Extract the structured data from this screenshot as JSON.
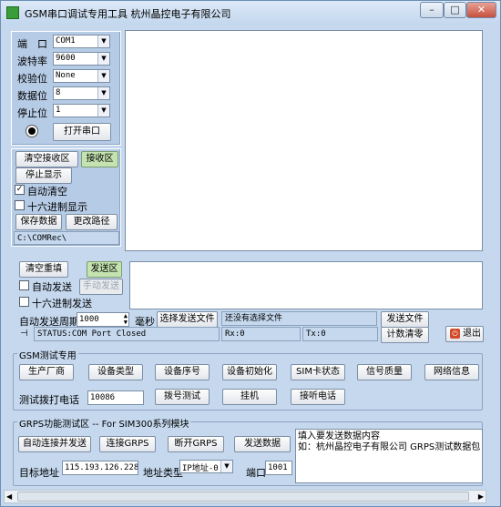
{
  "window": {
    "title": "GSM串口调试专用工具 杭州晶控电子有限公司",
    "min": "–",
    "max": "□",
    "close": "✕"
  },
  "serial": {
    "port_label": "端　口",
    "port_value": "COM1",
    "baud_label": "波特率",
    "baud_value": "9600",
    "parity_label": "校验位",
    "parity_value": "None",
    "databits_label": "数据位",
    "databits_value": "8",
    "stopbits_label": "停止位",
    "stopbits_value": "1",
    "open_label": "打开串口"
  },
  "receive": {
    "clear_label": "清空接收区",
    "area_label": "接收区",
    "stop_label": "停止显示",
    "auto_clear_label": "自动清空",
    "hex_label": "十六进制显示",
    "save_label": "保存数据",
    "change_path_label": "更改路径",
    "path_value": "C:\\COMRec\\"
  },
  "send": {
    "clear_label": "清空重填",
    "area_label": "发送区",
    "auto_label": "自动发送",
    "manual_label": "手动发送",
    "hex_label": "十六进制发送",
    "period_label": "自动发送周期",
    "period_value": "1000",
    "ms_label": "毫秒",
    "choose_file_label": "选择发送文件",
    "file_status": "还没有选择文件",
    "send_file_label": "发送文件",
    "count_clear_label": "计数清零",
    "exit_label": "退出",
    "status_text": "STATUS:COM Port Closed",
    "rx_text": "Rx:0",
    "tx_text": "Tx:0"
  },
  "gsm": {
    "group_title": "GSM测试专用",
    "buttons": [
      "生产厂商",
      "设备类型",
      "设备序号",
      "设备初始化",
      "SIM卡状态",
      "信号质量",
      "网络信息"
    ],
    "test_phone_label": "测试拨打电话",
    "phone_value": "10086",
    "dial_label": "拨号测试",
    "hangup_label": "挂机",
    "answer_label": "接听电话"
  },
  "grps": {
    "group_title": "GRPS功能测试区 -- For SIM300系列模块",
    "auto_connect_label": "自动连接并发送",
    "connect_label": "连接GRPS",
    "disconnect_label": "断开GRPS",
    "send_label": "发送数据",
    "target_label": "目标地址",
    "ip_value": "115.193.126.228",
    "addr_type_label": "地址类型",
    "addr_type_value": "IP地址-0",
    "port_label": "端口",
    "port_value": "1001",
    "text_line1": "填入要发送数据内容",
    "text_line2": "如：杭州晶控电子有限公司  GRPS测试数据包"
  }
}
